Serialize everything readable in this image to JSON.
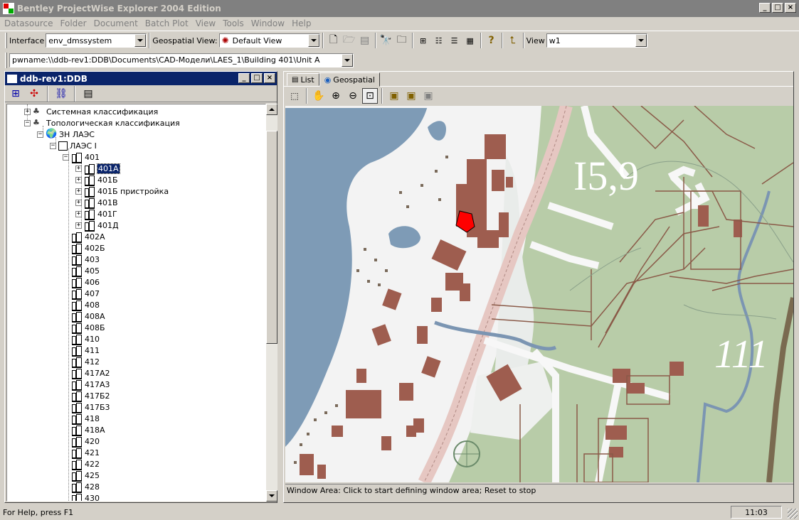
{
  "window": {
    "title": "Bentley ProjectWise Explorer 2004 Edition"
  },
  "menu": [
    "Datasource",
    "Folder",
    "Document",
    "Batch Plot",
    "View",
    "Tools",
    "Window",
    "Help"
  ],
  "toolbar": {
    "interface_label": "Interface",
    "interface_value": "env_dmssystem",
    "geoview_label": "Geospatial View:",
    "geoview_value": "Default View",
    "view_label": "View",
    "view_value": "w1"
  },
  "path": {
    "value": "pwname:\\\\ddb-rev1:DDB\\Documents\\CAD-Модели\\LAES_1\\Building 401\\Unit A"
  },
  "left_pane": {
    "title": "ddb-rev1:DDB"
  },
  "tree": {
    "sys_class": "Системная классификация",
    "topo_class": "Топологическая классификация",
    "zn": "ЗН ЛАЭС",
    "laes": "ЛАЭС I",
    "b401": "401",
    "sub401": [
      "401А",
      "401Б",
      "401Б пристройка",
      "401В",
      "401Г",
      "401Д"
    ],
    "others": [
      "402А",
      "402Б",
      "403",
      "405",
      "406",
      "407",
      "408",
      "408А",
      "408Б",
      "410",
      "411",
      "412",
      "417А2",
      "417А3",
      "417Б2",
      "417Б3",
      "418",
      "418А",
      "420",
      "421",
      "422",
      "425",
      "428",
      "430"
    ]
  },
  "right_pane": {
    "tab_list": "List",
    "tab_geo": "Geospatial"
  },
  "map": {
    "label1": "I5,9",
    "label2": "111"
  },
  "map_status": "Window Area: Click to start defining window area; Reset to stop",
  "status": {
    "help": "For Help, press F1",
    "time": "11:03"
  }
}
